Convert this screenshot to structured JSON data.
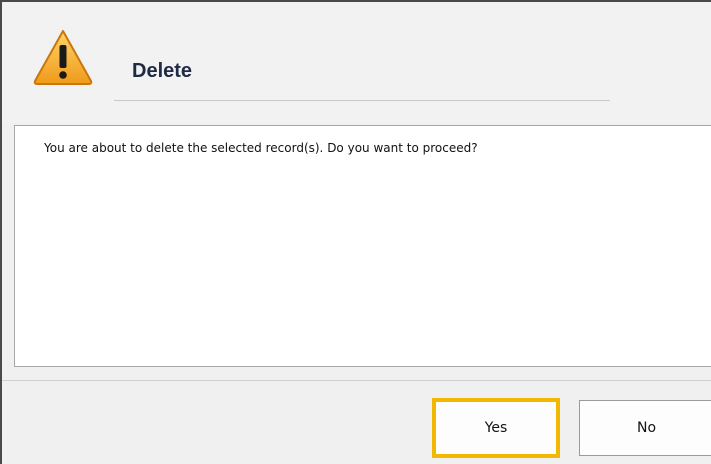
{
  "dialog": {
    "title": "Delete",
    "message": "You are about to delete the selected record(s). Do you want to proceed?",
    "icon": "warning-icon"
  },
  "buttons": {
    "yes_label": "Yes",
    "no_label": "No"
  },
  "colors": {
    "highlight": "#f2b700",
    "warning_fill": "#f5a623",
    "title_text": "#1f2a44"
  }
}
